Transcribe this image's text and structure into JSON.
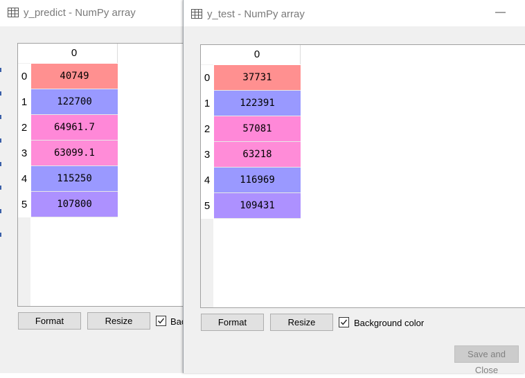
{
  "window_predict": {
    "title": "y_predict - NumPy array",
    "column_header": "0",
    "rows": [
      {
        "index": "0",
        "value": "40749",
        "color": "#ff9090"
      },
      {
        "index": "1",
        "value": "122700",
        "color": "#9999ff"
      },
      {
        "index": "2",
        "value": "64961.7",
        "color": "#ff88d8"
      },
      {
        "index": "3",
        "value": "63099.1",
        "color": "#ff8cd8"
      },
      {
        "index": "4",
        "value": "115250",
        "color": "#9a99ff"
      },
      {
        "index": "5",
        "value": "107800",
        "color": "#ad91ff"
      }
    ],
    "format_label": "Format",
    "resize_label": "Resize",
    "bg_color_label": "Bac",
    "bg_color_checked": true
  },
  "window_test": {
    "title": "y_test - NumPy array",
    "minimize_symbol": "—",
    "column_header": "0",
    "rows": [
      {
        "index": "0",
        "value": "37731",
        "color": "#ff9090"
      },
      {
        "index": "1",
        "value": "122391",
        "color": "#9999ff"
      },
      {
        "index": "2",
        "value": "57081",
        "color": "#ff88d8"
      },
      {
        "index": "3",
        "value": "63218",
        "color": "#ff8cd8"
      },
      {
        "index": "4",
        "value": "116969",
        "color": "#9a99ff"
      },
      {
        "index": "5",
        "value": "109431",
        "color": "#ad91ff"
      }
    ],
    "format_label": "Format",
    "resize_label": "Resize",
    "bg_color_label": "Background color",
    "bg_color_checked": true,
    "save_close_label": "Save and Close"
  },
  "icons": {
    "table": "table-icon",
    "check": "checkmark-icon",
    "minimize": "minimize-icon"
  }
}
